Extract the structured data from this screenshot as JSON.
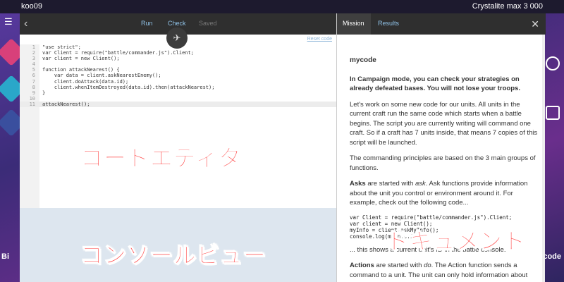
{
  "topbar": {
    "user": "koo09",
    "crystalite": "Crystalite max 3 000"
  },
  "side": {
    "left_bottom": "Bi",
    "right_bottom": "mycode"
  },
  "editor": {
    "toolbar": {
      "run": "Run",
      "check": "Check",
      "saved": "Saved"
    },
    "reset_link": "Reset code",
    "lines": [
      {
        "n": "1",
        "t": "\"use strict\";"
      },
      {
        "n": "2",
        "t": "var Client = require(\"battle/commander.js\").Client;"
      },
      {
        "n": "3",
        "t": "var client = new Client();"
      },
      {
        "n": "4",
        "t": ""
      },
      {
        "n": "5",
        "t": "function attackNearest() {"
      },
      {
        "n": "6",
        "t": "    var data = client.askNearestEnemy();"
      },
      {
        "n": "7",
        "t": "    client.doAttack(data.id);"
      },
      {
        "n": "8",
        "t": "    client.whenItemDestroyed(data.id).then(attackNearest);"
      },
      {
        "n": "9",
        "t": "}"
      },
      {
        "n": "10",
        "t": ""
      },
      {
        "n": "11",
        "t": "attackNearest();"
      }
    ],
    "label_editor": "コードエディタ",
    "label_console": "コンソールビュー"
  },
  "doc": {
    "tabs": {
      "mission": "Mission",
      "results": "Results"
    },
    "title": "mycode",
    "intro": "In Campaign mode, you can check your strategies on already defeated bases. You will not lose your troops.",
    "p1": "Let's work on some new code for our units. All units in the current craft run the same code which starts when a battle begins. The script you are currently writing will command one craft. So if a craft has 7 units inside, that means 7 copies of this script will be launched.",
    "p2": "The commanding principles are based on the 3 main groups of functions.",
    "p3_bold": "Asks",
    "p3_mid": " are started with ",
    "p3_ital": "ask",
    "p3_rest": ". Ask functions provide information about the unit you control or environment around it. For example, check out the following code...",
    "code": "var Client = require(\"battle/commander.js\").Client;\nvar client = new Client();\nmyInfo = client.askMyInfo();\nconsole.log(myInfo.id);",
    "p4": "... this shows a current unit's ID in the battle console.",
    "p5_bold": "Actions",
    "p5_mid": " are started with ",
    "p5_ital": "do",
    "p5_rest": ". The Action function sends a command to a unit. The unit can only hold information about",
    "label_doc": "ドキュメント"
  },
  "colors": {
    "accent": "#8fc1e6",
    "annotation": "#ff3b3b",
    "toolbar": "#2f2f2f",
    "console_bg": "#dde6ef"
  }
}
